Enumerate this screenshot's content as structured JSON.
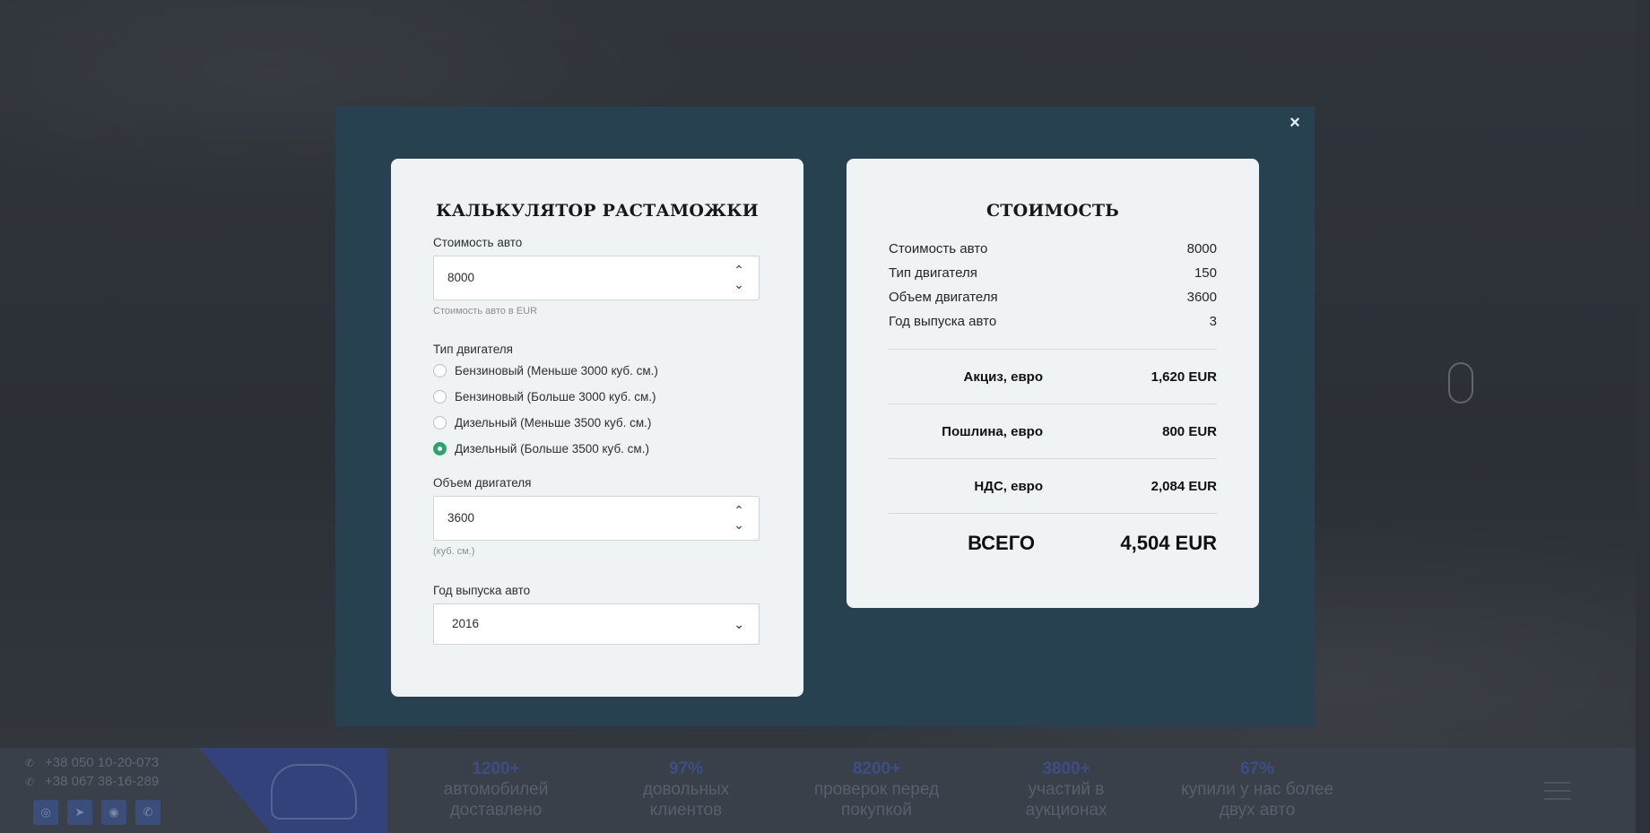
{
  "background": {
    "phones": [
      "+38 050 10-20-073",
      "+38 067 38-16-289"
    ],
    "socials": [
      "instagram-icon",
      "telegram-icon",
      "viber-icon",
      "whatsapp-icon"
    ],
    "stats": [
      {
        "num": "1200+",
        "line1": "автомобилей",
        "line2": "доставлено"
      },
      {
        "num": "97%",
        "line1": "довольных",
        "line2": "клиентов"
      },
      {
        "num": "8200+",
        "line1": "проверок перед",
        "line2": "покупкой"
      },
      {
        "num": "3800+",
        "line1": "участий в",
        "line2": "аукционах"
      },
      {
        "num": "67%",
        "line1": "купили у нас более",
        "line2": "двух авто"
      }
    ]
  },
  "modal": {
    "close_label": "×",
    "calculator": {
      "title": "КАЛЬКУЛЯТОР РАСТАМОЖКИ",
      "car_price": {
        "label": "Стоимость авто",
        "value": "8000",
        "hint": "Стоимость авто в EUR"
      },
      "engine_type": {
        "label": "Тип двигателя",
        "options": [
          {
            "label": "Бензиновый (Меньше 3000 куб. см.)",
            "checked": false
          },
          {
            "label": "Бензиновый (Больше 3000 куб. см.)",
            "checked": false
          },
          {
            "label": "Дизельный (Меньше 3500 куб. см.)",
            "checked": false
          },
          {
            "label": "Дизельный (Больше 3500 куб. см.)",
            "checked": true
          }
        ]
      },
      "engine_volume": {
        "label": "Объем двигателя",
        "value": "3600",
        "hint": "(куб. см.)"
      },
      "year": {
        "label": "Год выпуска авто",
        "value": "2016"
      }
    },
    "cost": {
      "title": "СТОИМОСТЬ",
      "rows": [
        {
          "label": "Стоимость авто",
          "value": "8000"
        },
        {
          "label": "Тип двигателя",
          "value": "150"
        },
        {
          "label": "Объем двигателя",
          "value": "3600"
        },
        {
          "label": "Год выпуска авто",
          "value": "3"
        }
      ],
      "excise": {
        "label": "Акциз, евро",
        "value": "1,620 EUR"
      },
      "duty": {
        "label": "Пошлина, евро",
        "value": "800 EUR"
      },
      "vat": {
        "label": "НДС, евро",
        "value": "2,084 EUR"
      },
      "total": {
        "label": "ВСЕГО",
        "value": "4,504 EUR"
      }
    }
  },
  "colors": {
    "modal_bg": "#274150",
    "card_bg": "#f0f3f4",
    "radio_checked": "#2aa66a"
  }
}
